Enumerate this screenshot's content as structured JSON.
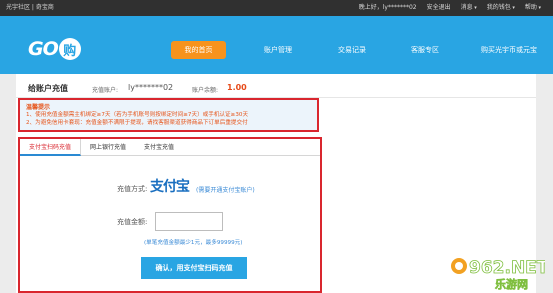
{
  "topbar": {
    "left": "光宇社区 | 奇宝商",
    "welcome": "晚上好，ly*******02",
    "exit": "安全退出",
    "messages": "消息",
    "wallet": "我的钱包",
    "help": "帮助"
  },
  "logo": {
    "text": "GO",
    "mark": "购"
  },
  "nav": {
    "items": [
      "我的首页",
      "账户管理",
      "交易记录",
      "客服专区",
      "购买光宇币或元宝"
    ],
    "active_index": 0
  },
  "page": {
    "title": "给账户充值",
    "account_label": "充值账户:",
    "account_value": "ly*******02",
    "balance_label": "账户余额:",
    "balance_value": "1.00"
  },
  "notice": {
    "title": "温馨提示",
    "lines": [
      "1、使用充值金额需主机绑定≥7天（若为手机账号则按绑定时间≥7天）或手机认证≥30天",
      "2、为避免信用卡套现：充值金额不满限于提现，请找客服渠道获得商品下订单后重提交付"
    ]
  },
  "tabs": [
    "支付宝扫码充值",
    "网上银行充值",
    "支付宝充值"
  ],
  "form": {
    "method_label": "充值方式:",
    "alipay_logo_text": "支付宝",
    "method_note": "(需要开通支付宝账户)",
    "amount_label": "充值金额:",
    "amount_value": "",
    "amount_hint": "(单笔充值金额最少1元，最多99999元)",
    "confirm_label": "确认，用支付宝扫码充值"
  },
  "watermark": {
    "text": "962.NET",
    "sub": "乐游网"
  },
  "colors": {
    "header": "#29a5e3",
    "active_nav": "#f7931d",
    "highlight_border": "#d9262e",
    "balance": "#e64a19"
  }
}
